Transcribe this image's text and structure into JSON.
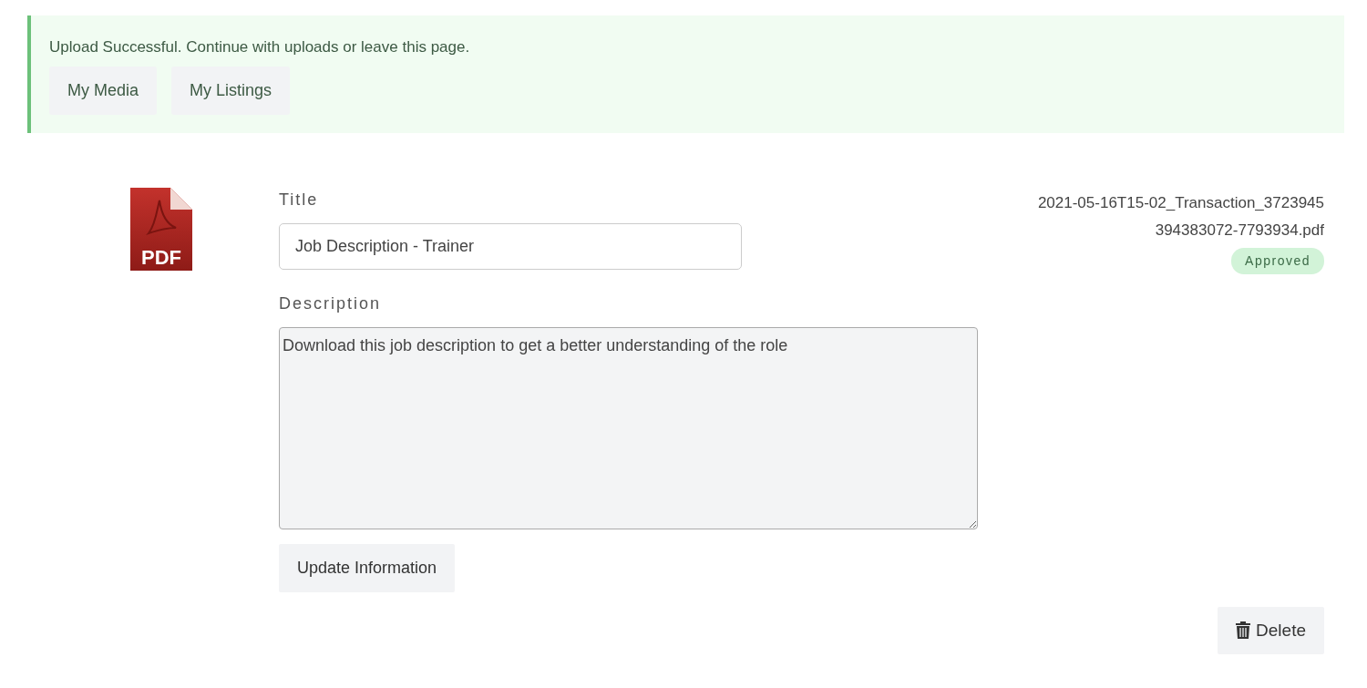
{
  "alert": {
    "message": "Upload Successful. Continue with uploads or leave this page.",
    "buttons": [
      "My Media",
      "My Listings"
    ]
  },
  "file": {
    "title_label": "Title",
    "title_value": "Job Description - Trainer",
    "description_label": "Description",
    "description_value": "Download this job description to get a better understanding of the role",
    "update_button": "Update Information",
    "filename": "2021-05-16T15-02_Transaction_3723945394383072-7793934.pdf",
    "status": "Approved",
    "icon_text": "PDF",
    "delete_button": "Delete"
  }
}
